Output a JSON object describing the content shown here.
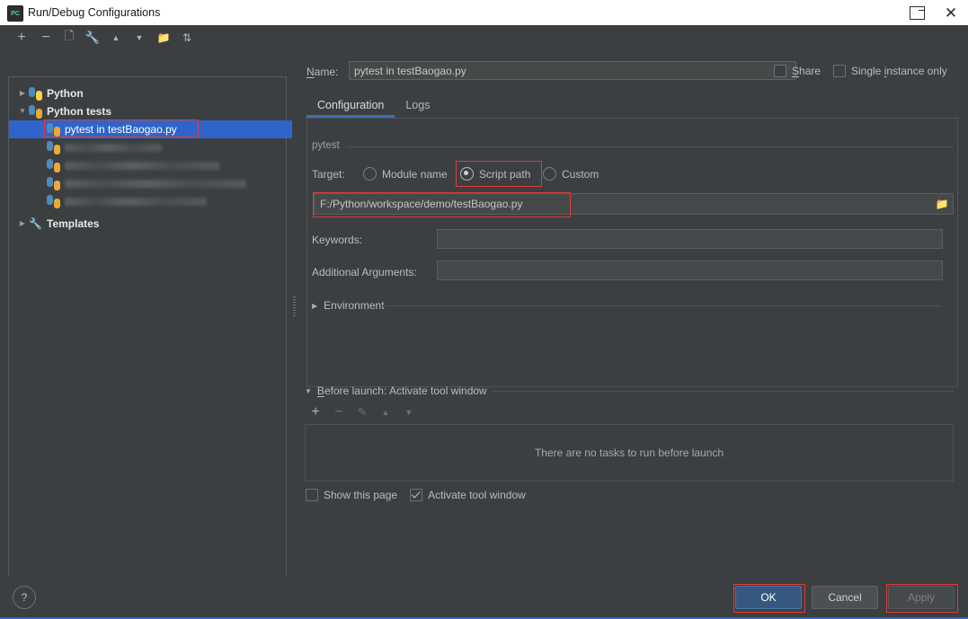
{
  "window": {
    "title": "Run/Debug Configurations",
    "app_icon": "pycharm-icon",
    "restore_icon": "restore-window-icon",
    "close_icon": "close-icon"
  },
  "left_toolbar": {
    "buttons": [
      {
        "name": "add",
        "glyph": "+"
      },
      {
        "name": "remove",
        "glyph": "−"
      },
      {
        "name": "copy",
        "glyph": "❐"
      },
      {
        "name": "edit-templates",
        "glyph": "🔧"
      },
      {
        "name": "move-up",
        "glyph": "▲"
      },
      {
        "name": "move-down",
        "glyph": "▼"
      },
      {
        "name": "new-folder",
        "glyph": "🗀"
      },
      {
        "name": "sort-configurations",
        "glyph": "⇅"
      }
    ]
  },
  "tree": {
    "nodes": [
      {
        "label": "Python",
        "icon": "python-icon",
        "expanded": false,
        "level": 0,
        "bold": true,
        "selected": false,
        "blurred": false
      },
      {
        "label": "Python tests",
        "icon": "python-tests-icon",
        "expanded": true,
        "level": 0,
        "bold": true,
        "selected": false,
        "blurred": false
      },
      {
        "label": "pytest in testBaogao.py",
        "icon": "python-tests-icon",
        "level": 1,
        "bold": false,
        "selected": true,
        "blurred": false
      },
      {
        "label": "",
        "icon": "python-tests-icon",
        "level": 1,
        "bold": false,
        "selected": false,
        "blurred": true,
        "blur_width": 108
      },
      {
        "label": "",
        "icon": "python-tests-icon",
        "level": 1,
        "bold": false,
        "selected": false,
        "blurred": true,
        "blur_width": 172
      },
      {
        "label": "",
        "icon": "python-tests-icon",
        "level": 1,
        "bold": false,
        "selected": false,
        "blurred": true,
        "blur_width": 202
      },
      {
        "label": "",
        "icon": "python-tests-icon",
        "level": 1,
        "bold": false,
        "selected": false,
        "blurred": true,
        "blur_width": 158
      },
      {
        "label": "Templates",
        "icon": "wrench-icon",
        "expanded": false,
        "level": 0,
        "bold": true,
        "selected": false,
        "blurred": false
      }
    ]
  },
  "form": {
    "name_label": "Name:",
    "name_value": "pytest in testBaogao.py",
    "share_label": "Share",
    "share_checked": false,
    "single_instance_label": "Single instance only",
    "single_instance_checked": false,
    "tabs": [
      {
        "label": "Configuration",
        "active": true
      },
      {
        "label": "Logs",
        "active": false
      }
    ],
    "section_title": "pytest",
    "target_label": "Target:",
    "target_options": [
      {
        "label": "Module name",
        "selected": false
      },
      {
        "label": "Script path",
        "selected": true
      },
      {
        "label": "Custom",
        "selected": false
      }
    ],
    "script_path_value": "F:/Python/workspace/demo/testBaogao.py",
    "browse_icon": "folder-browse-icon",
    "keywords_label": "Keywords:",
    "keywords_value": "",
    "additional_arguments_label": "Additional Arguments:",
    "additional_arguments_value": "",
    "environment_label": "Environment",
    "environment_expanded": false
  },
  "before_launch": {
    "title": "Before launch: Activate tool window",
    "expanded": true,
    "toolbar": [
      {
        "name": "add-task",
        "glyph": "+",
        "enabled": true
      },
      {
        "name": "remove-task",
        "glyph": "−",
        "enabled": false
      },
      {
        "name": "edit-task",
        "glyph": "✎",
        "enabled": false
      },
      {
        "name": "move-task-up",
        "glyph": "▲",
        "enabled": false
      },
      {
        "name": "move-task-down",
        "glyph": "▼",
        "enabled": false
      }
    ],
    "empty_text": "There are no tasks to run before launch",
    "show_page_label": "Show this page",
    "show_page_checked": false,
    "activate_tool_window_label": "Activate tool window",
    "activate_tool_window_checked": true
  },
  "footer": {
    "help_glyph": "?",
    "ok_label": "OK",
    "cancel_label": "Cancel",
    "apply_label": "Apply"
  },
  "colors": {
    "panel_bg": "#3c3f41",
    "selection_blue": "#2f65ca",
    "ok_blue": "#365880",
    "tab_underline": "#3d72b4",
    "annotation_red": "#e03b3b",
    "input_bg": "#45494a"
  }
}
